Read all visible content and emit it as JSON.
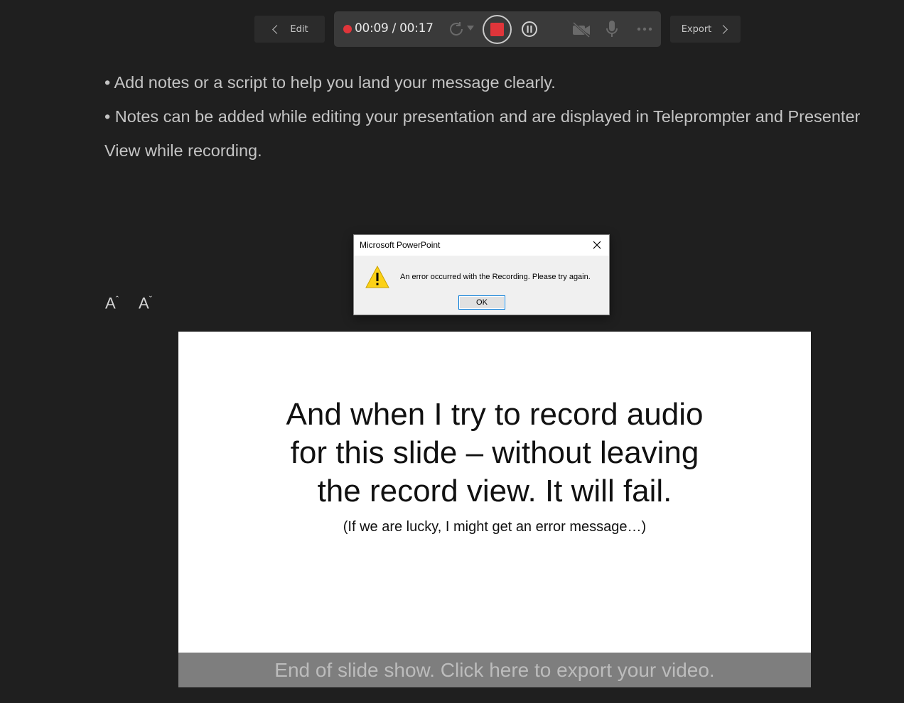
{
  "toolbar": {
    "edit_label": "Edit",
    "export_label": "Export",
    "timer": "00:09 / 00:17",
    "record_color": "#e0353a"
  },
  "icons": {
    "retake": "retake-icon",
    "stop": "stop-icon",
    "pause": "pause-icon",
    "camera": "camera-off-icon",
    "mic": "microphone-icon",
    "more": "more-icon"
  },
  "notes": {
    "lines": [
      "• Add notes or a script to help you land your message clearly.",
      "• Notes can be added while editing your presentation and are displayed in Teleprompter and Presenter View while recording."
    ]
  },
  "font_controls": {
    "increase": "A",
    "decrease": "A"
  },
  "slide": {
    "title_lines": [
      "And when I try to record audio",
      "for this slide – without leaving",
      "the record view. It will fail."
    ],
    "subtitle": "(If we are lucky, I might get an error message…)",
    "export_bar": "End of slide show. Click here to export your video."
  },
  "dialog": {
    "title": "Microsoft PowerPoint",
    "message": "An error occurred with the Recording. Please try again.",
    "ok_label": "OK"
  }
}
